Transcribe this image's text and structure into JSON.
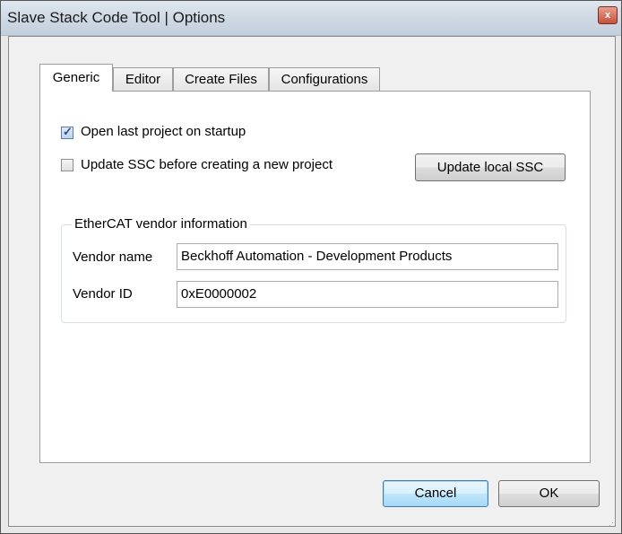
{
  "window": {
    "title": "Slave Stack Code Tool | Options",
    "close_glyph": "x"
  },
  "tabs": [
    {
      "label": "Generic",
      "active": true
    },
    {
      "label": "Editor",
      "active": false
    },
    {
      "label": "Create Files",
      "active": false
    },
    {
      "label": "Configurations",
      "active": false
    }
  ],
  "generic": {
    "open_last_project": {
      "label": "Open last project on startup",
      "checked": true
    },
    "update_ssc": {
      "label": "Update SSC before creating a new project",
      "checked": false
    },
    "update_local_ssc_button": "Update local SSC",
    "vendor_group": {
      "legend": "EtherCAT vendor  information",
      "vendor_name_label": "Vendor name",
      "vendor_name_value": "Beckhoff Automation - Development Products",
      "vendor_id_label": "Vendor ID",
      "vendor_id_value": "0xE0000002"
    }
  },
  "footer": {
    "cancel_label": "Cancel",
    "ok_label": "OK"
  }
}
